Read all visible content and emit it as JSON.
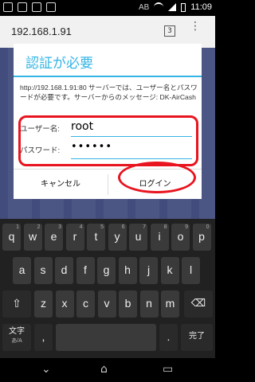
{
  "status": {
    "ab": "AB",
    "time": "11:09"
  },
  "browser": {
    "url": "192.168.1.91",
    "tab_count": "3"
  },
  "dialog": {
    "title": "認証が必要",
    "message": "http://192.168.1.91:80 サーバーでは、ユーザー名とパスワードが必要です。サーバーからのメッセージ: DK-AirCash",
    "username_label": "ユーザー名:",
    "username_value": "root",
    "password_label": "パスワード:",
    "password_value": "••••••",
    "cancel": "キャンセル",
    "login": "ログイン"
  },
  "keyboard": {
    "row1": [
      "q",
      "w",
      "e",
      "r",
      "t",
      "y",
      "u",
      "i",
      "o",
      "p"
    ],
    "row1_sub": [
      "1",
      "2",
      "3",
      "4",
      "5",
      "6",
      "7",
      "8",
      "9",
      "0"
    ],
    "row2": [
      "a",
      "s",
      "d",
      "f",
      "g",
      "h",
      "j",
      "k",
      "l"
    ],
    "row3": [
      "z",
      "x",
      "c",
      "v",
      "b",
      "n",
      "m"
    ],
    "shift": "⇧",
    "backspace": "⌫",
    "lang_label": "文字",
    "lang_sub": "あ/A",
    "comma": ",",
    "space_label": "",
    "period": ".",
    "done": "完了"
  }
}
